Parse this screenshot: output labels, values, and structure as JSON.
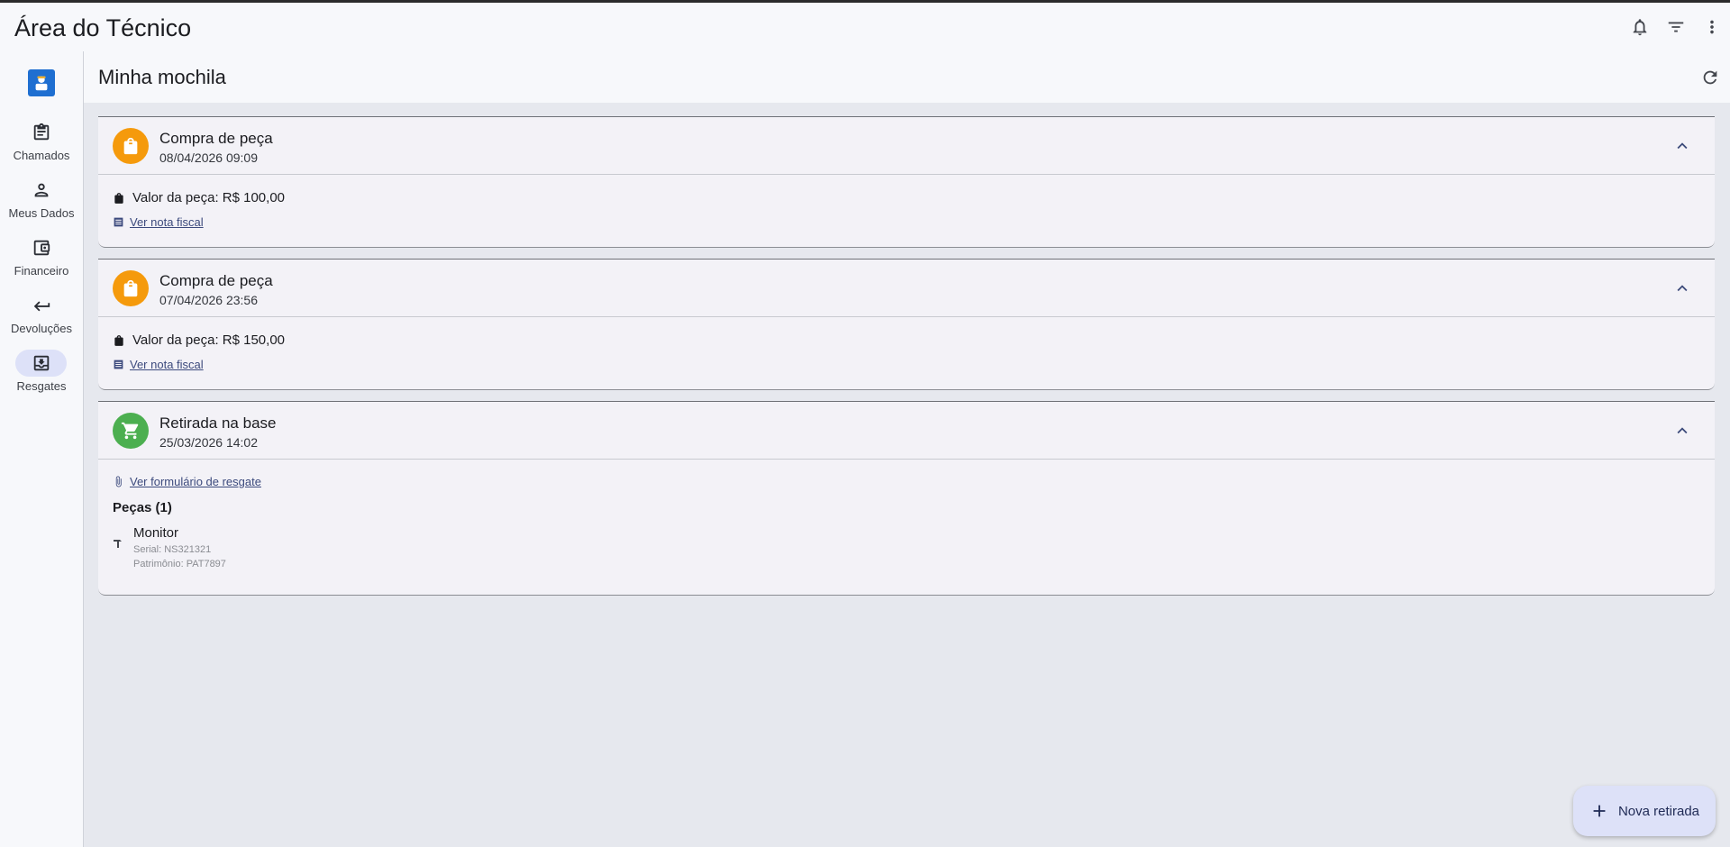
{
  "app": {
    "title": "Área do Técnico"
  },
  "topbar": {
    "icons": [
      "bell-icon",
      "filter-icon",
      "more-vert-icon"
    ]
  },
  "rail": {
    "items": [
      {
        "label": "Chamados",
        "icon": "clipboard-icon",
        "active": false
      },
      {
        "label": "Meus Dados",
        "icon": "person-icon",
        "active": false
      },
      {
        "label": "Financeiro",
        "icon": "wallet-icon",
        "active": false
      },
      {
        "label": "Devoluções",
        "icon": "return-arrow-icon",
        "active": false
      },
      {
        "label": "Resgates",
        "icon": "inbox-download-icon",
        "active": true
      }
    ]
  },
  "page": {
    "title": "Minha mochila"
  },
  "cards": [
    {
      "title": "Compra de peça",
      "date": "08/04/2026 09:09",
      "icon": "shopping-bag-icon",
      "icon_color": "#f59a0c",
      "price": "Valor da peça: R$ 100,00",
      "link": "Ver nota fiscal"
    },
    {
      "title": "Compra de peça",
      "date": "07/04/2026 23:56",
      "icon": "shopping-bag-icon",
      "icon_color": "#f59a0c",
      "price": "Valor da peça: R$ 150,00",
      "link": "Ver nota fiscal"
    },
    {
      "title": "Retirada na base",
      "date": "25/03/2026 14:02",
      "icon": "cart-icon",
      "icon_color": "#4caf50",
      "link": "Ver formulário de resgate",
      "parts_title": "Peças (1)",
      "part": {
        "name": "Monitor",
        "serial": "Serial: NS321321",
        "patrimonio": "Patrimônio: PAT7897"
      }
    }
  ],
  "fab": {
    "label": "Nova retirada"
  },
  "colors": {
    "accent": "#3c4a7d",
    "active_pill": "#dde1f8",
    "purchase": "#f59a0c",
    "pickup": "#4caf50"
  }
}
